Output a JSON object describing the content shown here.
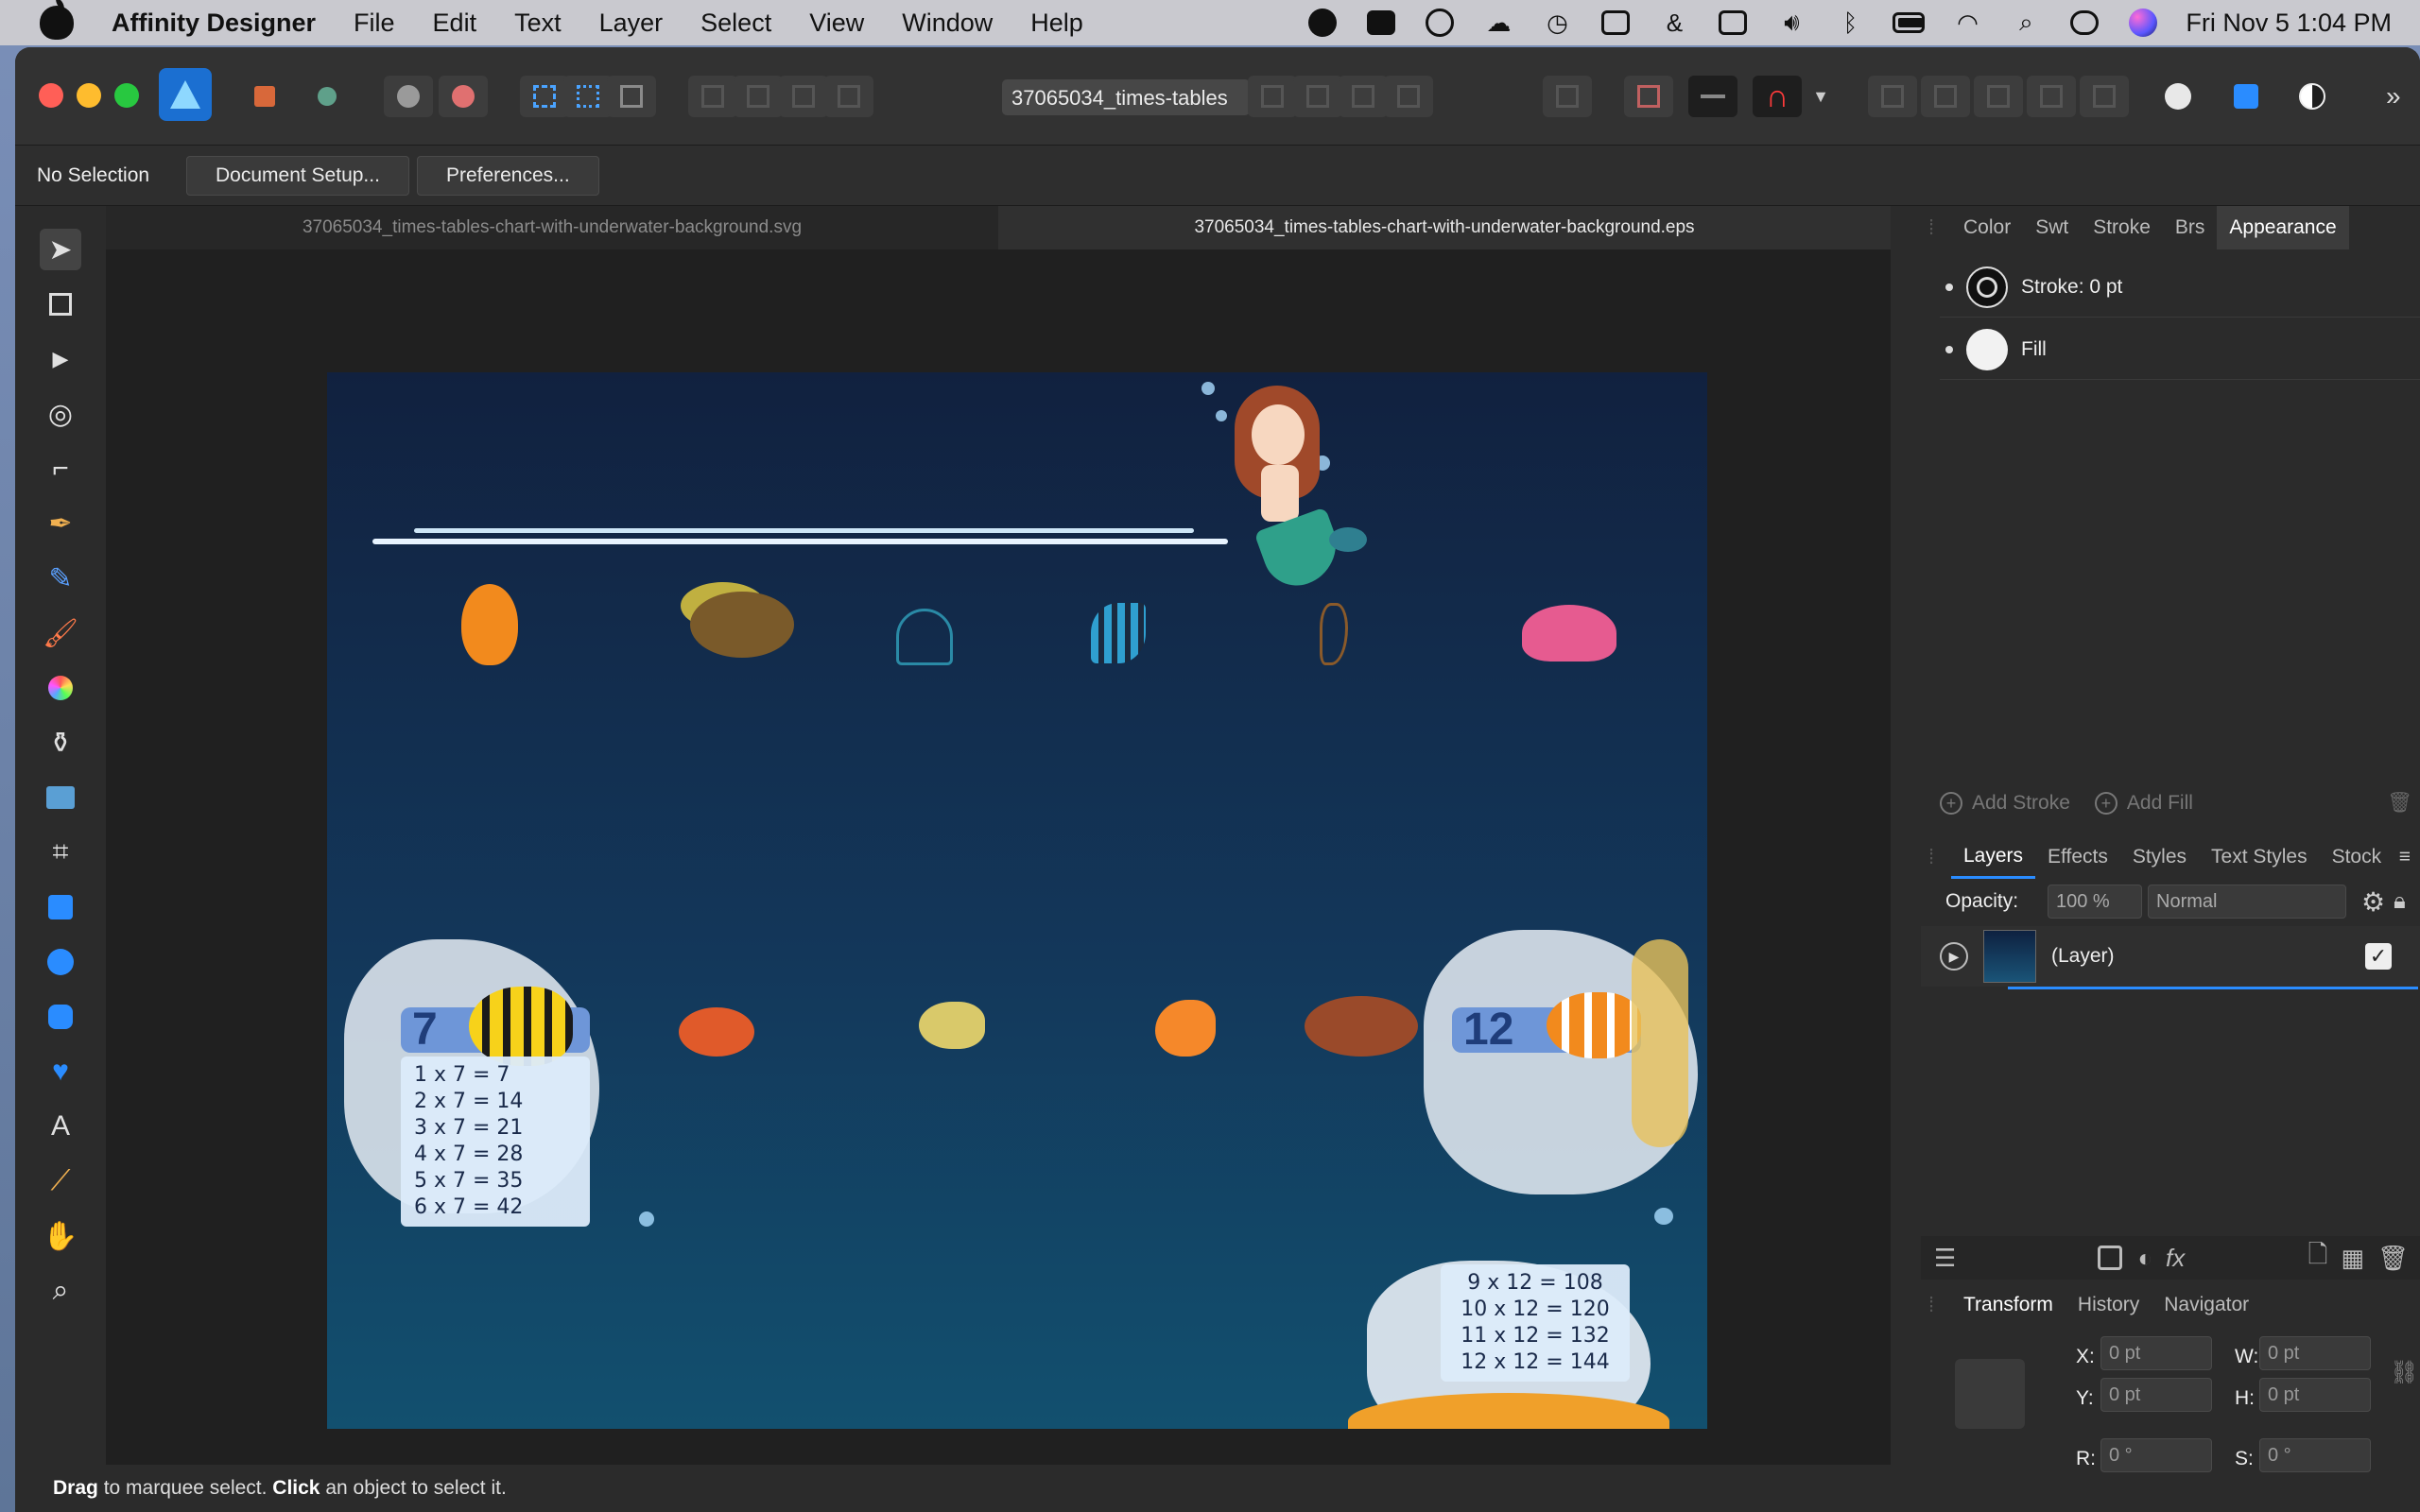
{
  "menubar": {
    "app_name": "Affinity Designer",
    "menus": [
      "File",
      "Edit",
      "Text",
      "Layer",
      "Select",
      "View",
      "Window",
      "Help"
    ],
    "clock": "Fri Nov 5  1:04 PM",
    "status_icons": [
      "app-icon",
      "html5-icon",
      "record-icon",
      "cloud-icon",
      "time-machine-icon",
      "calendar-icon",
      "ampersand-icon",
      "keyboard-icon",
      "volume-icon",
      "bluetooth-icon",
      "battery-icon",
      "wifi-icon",
      "search-icon",
      "control-center-icon",
      "siri-icon"
    ]
  },
  "toolbar": {
    "document_name": "37065034_times-tables"
  },
  "context": {
    "selection": "No Selection",
    "document_setup": "Document Setup...",
    "preferences": "Preferences..."
  },
  "tabs": {
    "doc1": "37065034_times-tables-chart-with-underwater-background.svg",
    "doc2": "37065034_times-tables-chart-with-underwater-background.eps"
  },
  "appearance": {
    "tabs": [
      "Color",
      "Swt",
      "Stroke",
      "Brs",
      "Appearance"
    ],
    "stroke_label": "Stroke: 0 pt",
    "fill_label": "Fill",
    "add_stroke": "Add Stroke",
    "add_fill": "Add Fill"
  },
  "layers": {
    "tabs": [
      "Layers",
      "Effects",
      "Styles",
      "Text Styles",
      "Stock"
    ],
    "opacity_label": "Opacity:",
    "opacity_value": "100 %",
    "blend_mode": "Normal",
    "layer_name": "(Layer)"
  },
  "transform": {
    "tabs": [
      "Transform",
      "History",
      "Navigator"
    ],
    "x_label": "X:",
    "x_value": "0 pt",
    "y_label": "Y:",
    "y_value": "0 pt",
    "w_label": "W:",
    "w_value": "0 pt",
    "h_label": "H:",
    "h_value": "0 pt",
    "r_label": "R:",
    "r_value": "0 °",
    "s_label": "S:",
    "s_value": "0 °"
  },
  "status": {
    "drag_word": "Drag",
    "drag_text": " to marquee select. ",
    "click_word": "Click",
    "click_text": " an object to select it."
  },
  "artboard": {
    "left_header": "7",
    "right_header": "12",
    "left_table": [
      "1 x 7 =   7",
      "2 x 7 = 14",
      "3 x 7 = 21",
      "4 x 7 = 28",
      "5 x 7 = 35",
      "6 x 7 = 42"
    ],
    "right_table": [
      "9 x 12 = 108",
      "10 x 12 = 120",
      "11 x 12 = 132",
      "12 x 12 = 144"
    ]
  }
}
